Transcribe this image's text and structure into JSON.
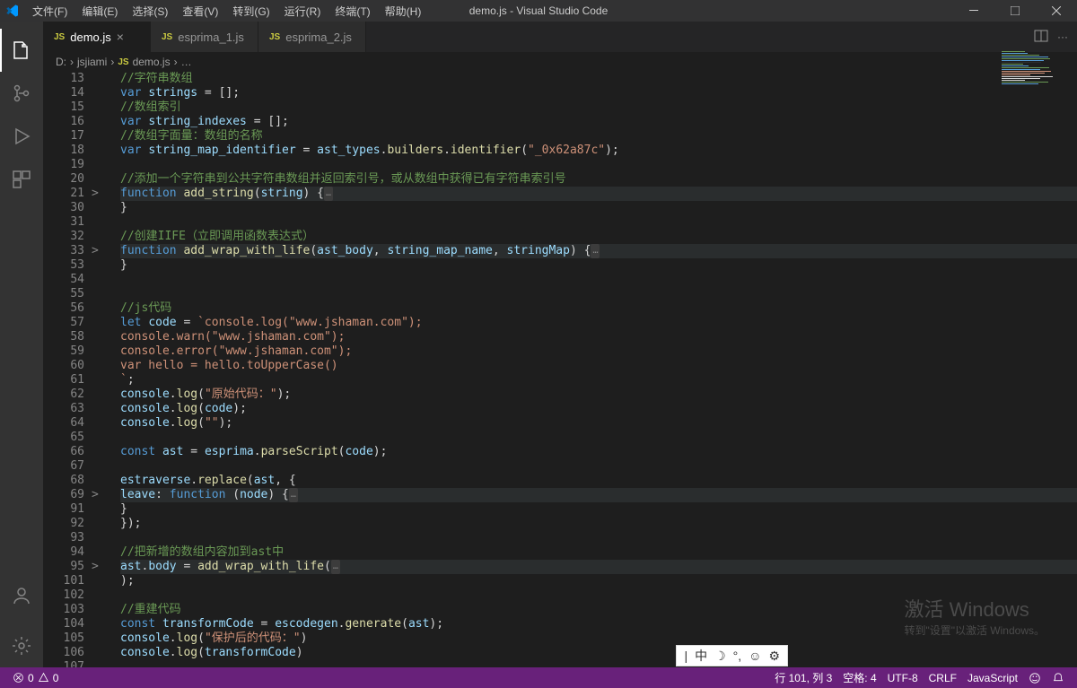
{
  "title": "demo.js - Visual Studio Code",
  "menu": [
    "文件(F)",
    "编辑(E)",
    "选择(S)",
    "查看(V)",
    "转到(G)",
    "运行(R)",
    "终端(T)",
    "帮助(H)"
  ],
  "tabs": [
    {
      "icon": "JS",
      "label": "demo.js",
      "active": true,
      "close": true
    },
    {
      "icon": "JS",
      "label": "esprima_1.js",
      "active": false,
      "close": false
    },
    {
      "icon": "JS",
      "label": "esprima_2.js",
      "active": false,
      "close": false
    }
  ],
  "breadcrumb": {
    "seg1": "D:",
    "seg2": "jsjiami",
    "seg3": "demo.js",
    "seg4": "…"
  },
  "statusbar": {
    "errors": "0",
    "warnings": "0",
    "ln": "行 101, 列 3",
    "spaces": "空格: 4",
    "enc": "UTF-8",
    "eol": "CRLF",
    "lang": "JavaScript"
  },
  "watermark": {
    "big": "激活 Windows",
    "small": "转到\"设置\"以激活 Windows。"
  },
  "ime": {
    "lang": "中"
  },
  "code": [
    {
      "n": "13",
      "tokens": [
        {
          "c": "cmt",
          "t": "//字符串数组"
        }
      ]
    },
    {
      "n": "14",
      "tokens": [
        {
          "c": "kw",
          "t": "var "
        },
        {
          "c": "var",
          "t": "strings"
        },
        {
          "c": "op",
          "t": " = [];"
        }
      ]
    },
    {
      "n": "15",
      "tokens": [
        {
          "c": "cmt",
          "t": "//数组索引"
        }
      ]
    },
    {
      "n": "16",
      "tokens": [
        {
          "c": "kw",
          "t": "var "
        },
        {
          "c": "var",
          "t": "string_indexes"
        },
        {
          "c": "op",
          "t": " = [];"
        }
      ]
    },
    {
      "n": "17",
      "tokens": [
        {
          "c": "cmt",
          "t": "//数组字面量：数组的名称"
        }
      ]
    },
    {
      "n": "18",
      "tokens": [
        {
          "c": "kw",
          "t": "var "
        },
        {
          "c": "var",
          "t": "string_map_identifier"
        },
        {
          "c": "op",
          "t": " = "
        },
        {
          "c": "var",
          "t": "ast_types"
        },
        {
          "c": "op",
          "t": "."
        },
        {
          "c": "fn",
          "t": "builders"
        },
        {
          "c": "op",
          "t": "."
        },
        {
          "c": "fn",
          "t": "identifier"
        },
        {
          "c": "op",
          "t": "("
        },
        {
          "c": "str",
          "t": "\"_0x62a87c\""
        },
        {
          "c": "op",
          "t": ");"
        }
      ]
    },
    {
      "n": "19",
      "tokens": []
    },
    {
      "n": "20",
      "tokens": [
        {
          "c": "cmt",
          "t": "//添加一个字符串到公共字符串数组并返回索引号，或从数组中获得已有字符串索引号"
        }
      ]
    },
    {
      "n": "21",
      "fold": ">",
      "hl": true,
      "tokens": [
        {
          "c": "kw",
          "t": "function "
        },
        {
          "c": "fn",
          "t": "add_string"
        },
        {
          "c": "op",
          "t": "("
        },
        {
          "c": "var",
          "t": "string"
        },
        {
          "c": "op",
          "t": ") {"
        },
        {
          "c": "fold-dots",
          "t": "…"
        }
      ]
    },
    {
      "n": "30",
      "tokens": [
        {
          "c": "op",
          "t": "}"
        }
      ]
    },
    {
      "n": "31",
      "tokens": []
    },
    {
      "n": "32",
      "tokens": [
        {
          "c": "cmt",
          "t": "//创建IIFE（立即调用函数表达式）"
        }
      ]
    },
    {
      "n": "33",
      "fold": ">",
      "hl": true,
      "tokens": [
        {
          "c": "kw",
          "t": "function "
        },
        {
          "c": "fn",
          "t": "add_wrap_with_life"
        },
        {
          "c": "op",
          "t": "("
        },
        {
          "c": "var",
          "t": "ast_body"
        },
        {
          "c": "op",
          "t": ", "
        },
        {
          "c": "var",
          "t": "string_map_name"
        },
        {
          "c": "op",
          "t": ", "
        },
        {
          "c": "var",
          "t": "stringMap"
        },
        {
          "c": "op",
          "t": ") {"
        },
        {
          "c": "fold-dots",
          "t": "…"
        }
      ]
    },
    {
      "n": "53",
      "tokens": [
        {
          "c": "op",
          "t": "}"
        }
      ]
    },
    {
      "n": "54",
      "tokens": []
    },
    {
      "n": "55",
      "tokens": []
    },
    {
      "n": "56",
      "tokens": [
        {
          "c": "cmt",
          "t": "//js代码"
        }
      ]
    },
    {
      "n": "57",
      "tokens": [
        {
          "c": "kw",
          "t": "let "
        },
        {
          "c": "var",
          "t": "code"
        },
        {
          "c": "op",
          "t": " = "
        },
        {
          "c": "str",
          "t": "`console.log(\"www.jshaman.com\");"
        }
      ]
    },
    {
      "n": "58",
      "tokens": [
        {
          "c": "str",
          "t": "console.warn(\"www.jshaman.com\");"
        }
      ]
    },
    {
      "n": "59",
      "tokens": [
        {
          "c": "str",
          "t": "console.error(\"www.jshaman.com\");"
        }
      ]
    },
    {
      "n": "60",
      "tokens": [
        {
          "c": "str",
          "t": "var hello = hello.toUpperCase()"
        }
      ]
    },
    {
      "n": "61",
      "tokens": [
        {
          "c": "str",
          "t": "`"
        },
        {
          "c": "op",
          "t": ";"
        }
      ]
    },
    {
      "n": "62",
      "tokens": [
        {
          "c": "var",
          "t": "console"
        },
        {
          "c": "op",
          "t": "."
        },
        {
          "c": "fn",
          "t": "log"
        },
        {
          "c": "op",
          "t": "("
        },
        {
          "c": "str",
          "t": "\"原始代码：\""
        },
        {
          "c": "op",
          "t": ");"
        }
      ]
    },
    {
      "n": "63",
      "tokens": [
        {
          "c": "var",
          "t": "console"
        },
        {
          "c": "op",
          "t": "."
        },
        {
          "c": "fn",
          "t": "log"
        },
        {
          "c": "op",
          "t": "("
        },
        {
          "c": "var",
          "t": "code"
        },
        {
          "c": "op",
          "t": ");"
        }
      ]
    },
    {
      "n": "64",
      "tokens": [
        {
          "c": "var",
          "t": "console"
        },
        {
          "c": "op",
          "t": "."
        },
        {
          "c": "fn",
          "t": "log"
        },
        {
          "c": "op",
          "t": "("
        },
        {
          "c": "str",
          "t": "\"\""
        },
        {
          "c": "op",
          "t": ");"
        }
      ]
    },
    {
      "n": "65",
      "tokens": []
    },
    {
      "n": "66",
      "tokens": [
        {
          "c": "kw",
          "t": "const "
        },
        {
          "c": "var",
          "t": "ast"
        },
        {
          "c": "op",
          "t": " = "
        },
        {
          "c": "var",
          "t": "esprima"
        },
        {
          "c": "op",
          "t": "."
        },
        {
          "c": "fn",
          "t": "parseScript"
        },
        {
          "c": "op",
          "t": "("
        },
        {
          "c": "var",
          "t": "code"
        },
        {
          "c": "op",
          "t": ");"
        }
      ]
    },
    {
      "n": "67",
      "tokens": []
    },
    {
      "n": "68",
      "tokens": [
        {
          "c": "var",
          "t": "estraverse"
        },
        {
          "c": "op",
          "t": "."
        },
        {
          "c": "fn",
          "t": "replace"
        },
        {
          "c": "op",
          "t": "("
        },
        {
          "c": "var",
          "t": "ast"
        },
        {
          "c": "op",
          "t": ", {"
        }
      ]
    },
    {
      "n": "69",
      "fold": ">",
      "hl": true,
      "indent": "    ",
      "tokens": [
        {
          "c": "var",
          "t": "leave"
        },
        {
          "c": "op",
          "t": ": "
        },
        {
          "c": "kw",
          "t": "function "
        },
        {
          "c": "op",
          "t": "("
        },
        {
          "c": "var",
          "t": "node"
        },
        {
          "c": "op",
          "t": ") {"
        },
        {
          "c": "fold-dots",
          "t": "…"
        }
      ]
    },
    {
      "n": "91",
      "indent": "    ",
      "tokens": [
        {
          "c": "op",
          "t": "}"
        }
      ]
    },
    {
      "n": "92",
      "tokens": [
        {
          "c": "op",
          "t": "});"
        }
      ]
    },
    {
      "n": "93",
      "tokens": []
    },
    {
      "n": "94",
      "tokens": [
        {
          "c": "cmt",
          "t": "//把新增的数组内容加到ast中"
        }
      ]
    },
    {
      "n": "95",
      "fold": ">",
      "hl": true,
      "tokens": [
        {
          "c": "var",
          "t": "ast"
        },
        {
          "c": "op",
          "t": "."
        },
        {
          "c": "var",
          "t": "body"
        },
        {
          "c": "op",
          "t": " = "
        },
        {
          "c": "fn",
          "t": "add_wrap_with_life"
        },
        {
          "c": "op",
          "t": "("
        },
        {
          "c": "fold-dots",
          "t": "…"
        }
      ]
    },
    {
      "n": "101",
      "tokens": [
        {
          "c": "op",
          "t": ");"
        }
      ]
    },
    {
      "n": "102",
      "tokens": []
    },
    {
      "n": "103",
      "tokens": [
        {
          "c": "cmt",
          "t": "//重建代码"
        }
      ]
    },
    {
      "n": "104",
      "tokens": [
        {
          "c": "kw",
          "t": "const "
        },
        {
          "c": "var",
          "t": "transformCode"
        },
        {
          "c": "op",
          "t": " = "
        },
        {
          "c": "var",
          "t": "escodegen"
        },
        {
          "c": "op",
          "t": "."
        },
        {
          "c": "fn",
          "t": "generate"
        },
        {
          "c": "op",
          "t": "("
        },
        {
          "c": "var",
          "t": "ast"
        },
        {
          "c": "op",
          "t": ");"
        }
      ]
    },
    {
      "n": "105",
      "tokens": [
        {
          "c": "var",
          "t": "console"
        },
        {
          "c": "op",
          "t": "."
        },
        {
          "c": "fn",
          "t": "log"
        },
        {
          "c": "op",
          "t": "("
        },
        {
          "c": "str",
          "t": "\"保护后的代码：\""
        },
        {
          "c": "op",
          "t": ")"
        }
      ]
    },
    {
      "n": "106",
      "tokens": [
        {
          "c": "var",
          "t": "console"
        },
        {
          "c": "op",
          "t": "."
        },
        {
          "c": "fn",
          "t": "log"
        },
        {
          "c": "op",
          "t": "("
        },
        {
          "c": "var",
          "t": "transformCode"
        },
        {
          "c": "op",
          "t": ")"
        }
      ]
    },
    {
      "n": "107",
      "tokens": []
    }
  ],
  "minimap_colors": [
    "#6a9955",
    "#569cd6",
    "#6a9955",
    "#569cd6",
    "#6a9955",
    "#569cd6",
    "#2a2d2e",
    "#6a9955",
    "#569cd6",
    "#6a9955",
    "#569cd6",
    "#ce9178",
    "#ce9178",
    "#ce9178",
    "#d4d4d4",
    "#d4d4d4",
    "#d4d4d4",
    "#6a9955",
    "#569cd6"
  ]
}
